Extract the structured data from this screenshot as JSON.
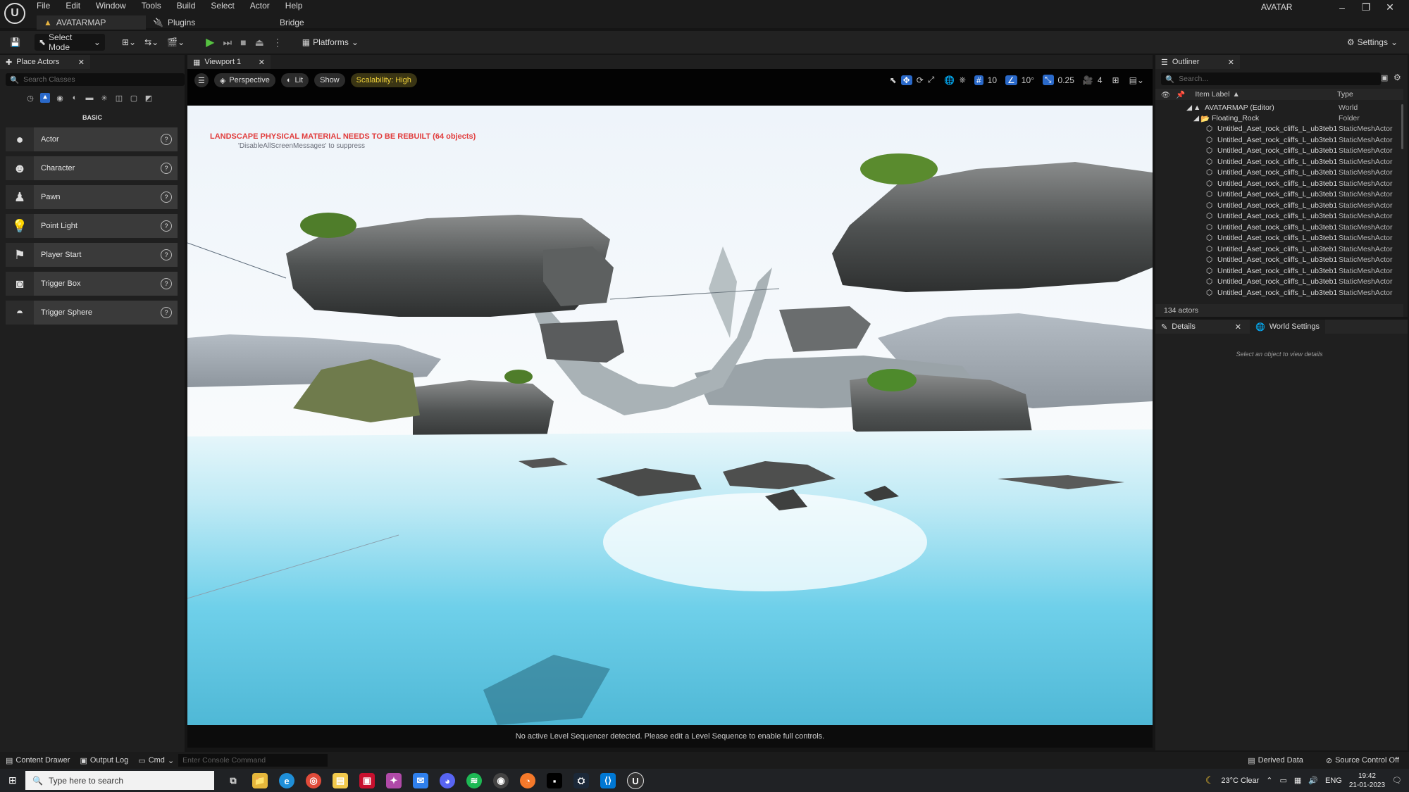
{
  "app": {
    "project_name": "AVATAR"
  },
  "menu": [
    "File",
    "Edit",
    "Window",
    "Tools",
    "Build",
    "Select",
    "Actor",
    "Help"
  ],
  "doc_tabs": {
    "map": "AVATARMAP",
    "plugins": "Plugins",
    "bridge": "Bridge"
  },
  "window_controls": {
    "minimize": "–",
    "restore": "❐",
    "close": "✕"
  },
  "toolbar": {
    "select_mode": "Select Mode",
    "platforms": "Platforms",
    "settings": "Settings"
  },
  "place_actors": {
    "tab": "Place Actors",
    "search_placeholder": "Search Classes",
    "category": "BASIC",
    "items": [
      {
        "label": "Actor",
        "icon": "actor-icon"
      },
      {
        "label": "Character",
        "icon": "character-icon"
      },
      {
        "label": "Pawn",
        "icon": "pawn-icon"
      },
      {
        "label": "Point Light",
        "icon": "point-light-icon"
      },
      {
        "label": "Player Start",
        "icon": "player-start-icon"
      },
      {
        "label": "Trigger Box",
        "icon": "trigger-box-icon"
      },
      {
        "label": "Trigger Sphere",
        "icon": "trigger-sphere-icon"
      }
    ]
  },
  "viewport": {
    "tab": "Viewport 1",
    "perspective": "Perspective",
    "lit": "Lit",
    "show": "Show",
    "scalability": "Scalability: High",
    "grid_snap": "10",
    "rotation_snap": "10°",
    "scale_snap": "0.25",
    "camera_speed": "4",
    "warning": "LANDSCAPE PHYSICAL MATERIAL NEEDS TO BE REBUILT (64 objects)",
    "warning_hint": "'DisableAllScreenMessages' to suppress",
    "sequencer_message": "No active Level Sequencer detected. Please edit a Level Sequence to enable full controls."
  },
  "outliner": {
    "tab": "Outliner",
    "search_placeholder": "Search...",
    "col_label": "Item Label",
    "col_type": "Type",
    "world": {
      "name": "AVATARMAP (Editor)",
      "type": "World"
    },
    "folder": {
      "name": "Floating_Rock",
      "type": "Folder"
    },
    "rows": [
      {
        "name": "Untitled_Aset_rock_cliffs_L_ub3teb1",
        "type": "StaticMeshActor"
      },
      {
        "name": "Untitled_Aset_rock_cliffs_L_ub3teb1",
        "type": "StaticMeshActor"
      },
      {
        "name": "Untitled_Aset_rock_cliffs_L_ub3teb1",
        "type": "StaticMeshActor"
      },
      {
        "name": "Untitled_Aset_rock_cliffs_L_ub3teb1",
        "type": "StaticMeshActor"
      },
      {
        "name": "Untitled_Aset_rock_cliffs_L_ub3teb1",
        "type": "StaticMeshActor"
      },
      {
        "name": "Untitled_Aset_rock_cliffs_L_ub3teb1",
        "type": "StaticMeshActor"
      },
      {
        "name": "Untitled_Aset_rock_cliffs_L_ub3teb1",
        "type": "StaticMeshActor"
      },
      {
        "name": "Untitled_Aset_rock_cliffs_L_ub3teb1",
        "type": "StaticMeshActor"
      },
      {
        "name": "Untitled_Aset_rock_cliffs_L_ub3teb1",
        "type": "StaticMeshActor"
      },
      {
        "name": "Untitled_Aset_rock_cliffs_L_ub3teb1",
        "type": "StaticMeshActor"
      },
      {
        "name": "Untitled_Aset_rock_cliffs_L_ub3teb1",
        "type": "StaticMeshActor"
      },
      {
        "name": "Untitled_Aset_rock_cliffs_L_ub3teb1",
        "type": "StaticMeshActor"
      },
      {
        "name": "Untitled_Aset_rock_cliffs_L_ub3teb1",
        "type": "StaticMeshActor"
      },
      {
        "name": "Untitled_Aset_rock_cliffs_L_ub3teb1",
        "type": "StaticMeshActor"
      },
      {
        "name": "Untitled_Aset_rock_cliffs_L_ub3teb1",
        "type": "StaticMeshActor"
      },
      {
        "name": "Untitled_Aset_rock_cliffs_L_ub3teb1",
        "type": "StaticMeshActor"
      }
    ],
    "actor_count": "134 actors"
  },
  "details": {
    "tab": "Details",
    "world_settings_tab": "World Settings",
    "empty_message": "Select an object to view details"
  },
  "statusbar": {
    "content_drawer": "Content Drawer",
    "output_log": "Output Log",
    "cmd": "Cmd",
    "console_placeholder": "Enter Console Command",
    "derived_data": "Derived Data",
    "source_control": "Source Control Off"
  },
  "taskbar": {
    "search_placeholder": "Type here to search",
    "weather": "23°C  Clear",
    "language": "ENG",
    "time": "19:42",
    "date": "21-01-2023"
  },
  "colors": {
    "accent_blue": "#2a69c9",
    "play_green": "#56c241",
    "warning_red": "#e13c3c",
    "scalability_yellow": "#f2d33a"
  }
}
